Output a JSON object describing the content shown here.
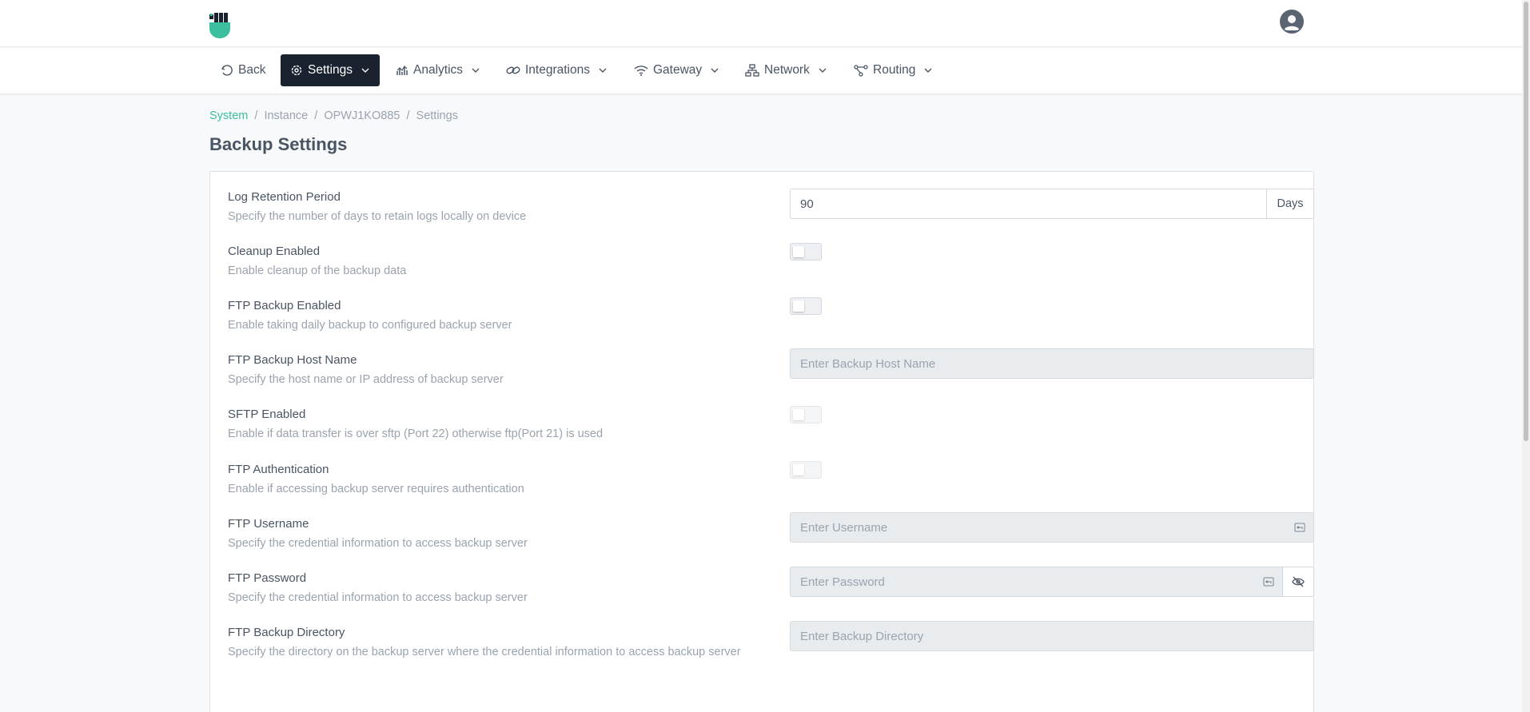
{
  "nav": {
    "back": "Back",
    "settings": "Settings",
    "analytics": "Analytics",
    "integrations": "Integrations",
    "gateway": "Gateway",
    "network": "Network",
    "routing": "Routing"
  },
  "breadcrumb": {
    "system": "System",
    "instance": "Instance",
    "device": "OPWJ1KO885",
    "current": "Settings",
    "separator": "/"
  },
  "page_title": "Backup Settings",
  "fields": {
    "log_retention": {
      "label": "Log Retention Period",
      "description": "Specify the number of days to retain logs locally on device",
      "value": "90",
      "unit": "Days"
    },
    "cleanup": {
      "label": "Cleanup Enabled",
      "description": "Enable cleanup of the backup data",
      "checked": false
    },
    "ftp_backup": {
      "label": "FTP Backup Enabled",
      "description": "Enable taking daily backup to configured backup server",
      "checked": false
    },
    "host_name": {
      "label": "FTP Backup Host Name",
      "description": "Specify the host name or IP address of backup server",
      "placeholder": "Enter Backup Host Name"
    },
    "sftp": {
      "label": "SFTP Enabled",
      "description": "Enable if data transfer is over sftp (Port 22) otherwise ftp(Port 21) is used",
      "checked": false
    },
    "ftp_auth": {
      "label": "FTP Authentication",
      "description": "Enable if accessing backup server requires authentication",
      "checked": false
    },
    "username": {
      "label": "FTP Username",
      "description": "Specify the credential information to access backup server",
      "placeholder": "Enter Username"
    },
    "password": {
      "label": "FTP Password",
      "description": "Specify the credential information to access backup server",
      "placeholder": "Enter Password"
    },
    "directory": {
      "label": "FTP Backup Directory",
      "description": "Specify the directory on the backup server where the credential information to access backup server",
      "placeholder": "Enter Backup Directory"
    }
  },
  "colors": {
    "accent": "#3bbf9e",
    "nav_active_bg": "#1a2230",
    "text": "#4a5563",
    "muted": "#9aa3ae"
  }
}
